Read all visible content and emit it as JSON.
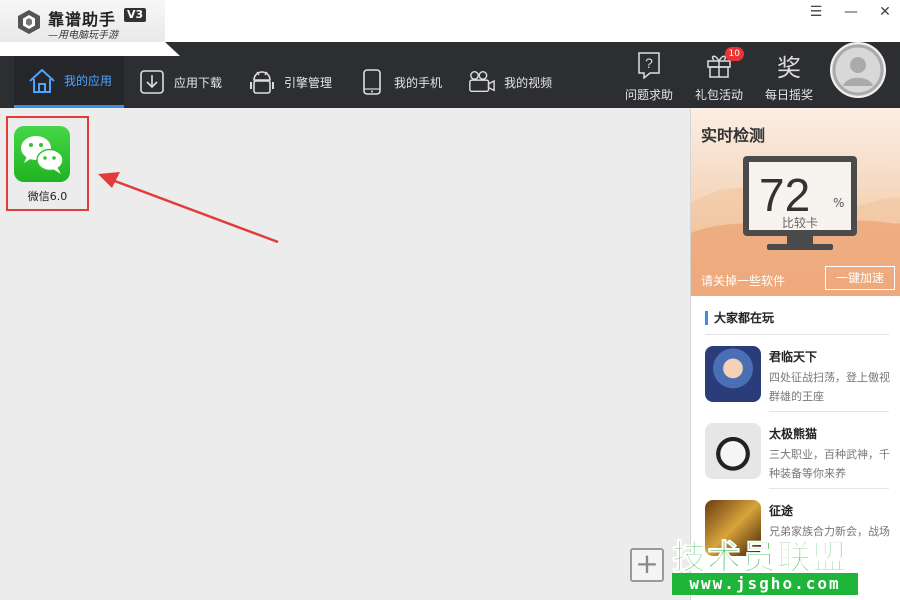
{
  "titlebar": {
    "app_name": "靠谱助手",
    "version": "V3",
    "slogan": "—用电脑玩手游",
    "controls": {
      "menu": "☰",
      "minimize": "—",
      "close": "✕"
    }
  },
  "nav": {
    "items": [
      {
        "label": "我的应用",
        "icon": "home-icon"
      },
      {
        "label": "应用下载",
        "icon": "download-icon"
      },
      {
        "label": "引擎管理",
        "icon": "android-icon"
      },
      {
        "label": "我的手机",
        "icon": "phone-icon"
      },
      {
        "label": "我的视频",
        "icon": "video-camera-icon"
      }
    ],
    "right": [
      {
        "label": "问题求助",
        "icon": "help-icon"
      },
      {
        "label": "礼包活动",
        "icon": "gift-icon",
        "badge": "10"
      },
      {
        "label": "每日摇奖",
        "icon": "lottery-icon",
        "glyph": "奖"
      }
    ]
  },
  "main": {
    "apps": [
      {
        "label": "微信6.0",
        "icon": "wechat-icon"
      }
    ],
    "add_button": "+"
  },
  "sidebar": {
    "monitor": {
      "title": "实时检测",
      "score": "72",
      "score_unit": "%",
      "score_label": "比较卡",
      "hint": "请关掉一些软件",
      "accel_button": "一键加速"
    },
    "popular": {
      "title": "大家都在玩",
      "games": [
        {
          "name": "君临天下",
          "desc": "四处征战扫荡，登上傲视群雄的王座"
        },
        {
          "name": "太极熊猫",
          "desc": "三大职业，百种武神，千种装备等你来养"
        },
        {
          "name": "征途",
          "desc": "兄弟家族合力新会，战场"
        }
      ]
    }
  },
  "watermark": {
    "text": "技术员联盟",
    "url": "www.jsgho.com"
  },
  "colors": {
    "accent": "#3a8ee6",
    "navbar": "#2c2e32",
    "highlight_red": "#e23b3b",
    "wechat_green": "#2cc52e",
    "watermark_green": "#1fb43a"
  }
}
